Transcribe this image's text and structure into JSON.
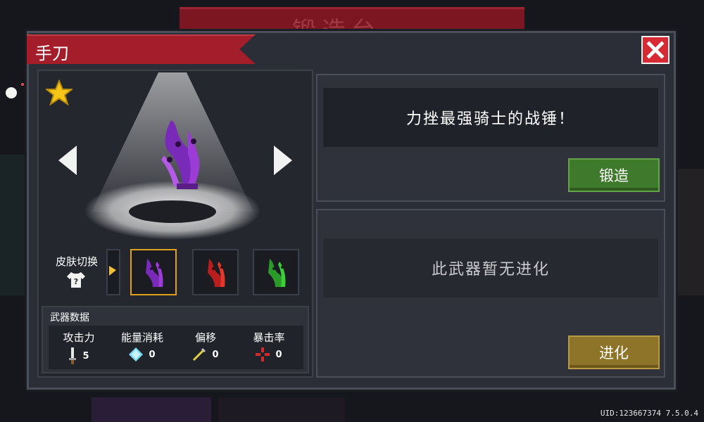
{
  "background": {
    "banner_text": "锻造台"
  },
  "dialog": {
    "title": "手刀",
    "close_icon": "close-x-icon"
  },
  "weapon": {
    "rarity_icon": "gold-star-icon",
    "description": "力挫最强骑士的战锤！",
    "forge_label": "锻造",
    "evolution_text": "此武器暂无进化",
    "evolve_label": "进化"
  },
  "skins": {
    "label": "皮肤切换",
    "icon": "shirt-question-icon",
    "slots": [
      {
        "color": "#f0c030",
        "state": "partial"
      },
      {
        "color": "#9b3cd6",
        "state": "selected"
      },
      {
        "color": "#d62a2a",
        "state": "normal"
      },
      {
        "color": "#3ccf3a",
        "state": "normal"
      }
    ]
  },
  "stats": {
    "title": "武器数据",
    "items": [
      {
        "name": "攻击力",
        "icon": "sword-icon",
        "value": "5"
      },
      {
        "name": "能量消耗",
        "icon": "diamond-icon",
        "value": "0"
      },
      {
        "name": "偏移",
        "icon": "needle-icon",
        "value": "0"
      },
      {
        "name": "暴击率",
        "icon": "crosshair-icon",
        "value": "0"
      }
    ]
  },
  "footer": {
    "uid": "UID:123667374 7.5.0.4"
  },
  "colors": {
    "accent_red": "#a31d2a",
    "forge_green": "#3f7a2c",
    "evolve_gold": "#8e7428",
    "selected_border": "#e0a21c"
  }
}
